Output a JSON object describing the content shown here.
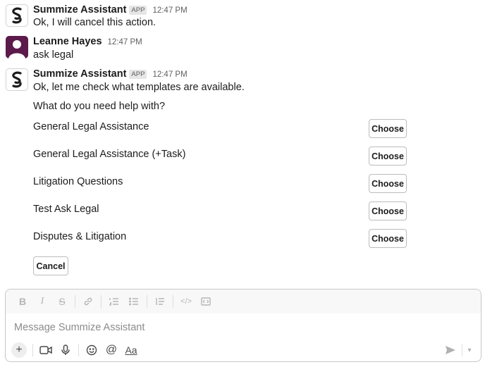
{
  "messages": [
    {
      "sender": "Summize Assistant",
      "badge": "APP",
      "time": "12:47 PM",
      "lines": [
        "Ok, I will cancel this action."
      ]
    },
    {
      "sender": "Leanne Hayes",
      "time": "12:47 PM",
      "lines": [
        "ask legal"
      ]
    },
    {
      "sender": "Summize Assistant",
      "badge": "APP",
      "time": "12:47 PM",
      "lines": [
        "Ok, let me check what templates are available.",
        "What do you need help with?"
      ]
    }
  ],
  "options": [
    {
      "label": "General Legal Assistance",
      "button": "Choose"
    },
    {
      "label": "General Legal Assistance (+Task)",
      "button": "Choose"
    },
    {
      "label": "Litigation Questions",
      "button": "Choose"
    },
    {
      "label": "Test Ask Legal",
      "button": "Choose"
    },
    {
      "label": "Disputes & Litigation",
      "button": "Choose"
    }
  ],
  "cancel_label": "Cancel",
  "composer": {
    "placeholder": "Message Summize Assistant",
    "format_icons": [
      "bold-icon",
      "italic-icon",
      "strikethrough-icon",
      "link-icon",
      "ordered-list-icon",
      "bulleted-list-icon",
      "blockquote-icon",
      "code-icon",
      "code-block-icon"
    ],
    "action_icons": [
      "plus-icon",
      "video-icon",
      "microphone-icon",
      "emoji-icon",
      "mention-icon",
      "formatting-icon"
    ],
    "format_labels": {
      "bold": "B",
      "italic": "I",
      "strike": "S",
      "code": "</>",
      "aa": "Aa",
      "at": "@"
    }
  },
  "colors": {
    "user_avatar": "#5b1a4a",
    "text": "#1d1c1d",
    "muted": "#616061"
  }
}
